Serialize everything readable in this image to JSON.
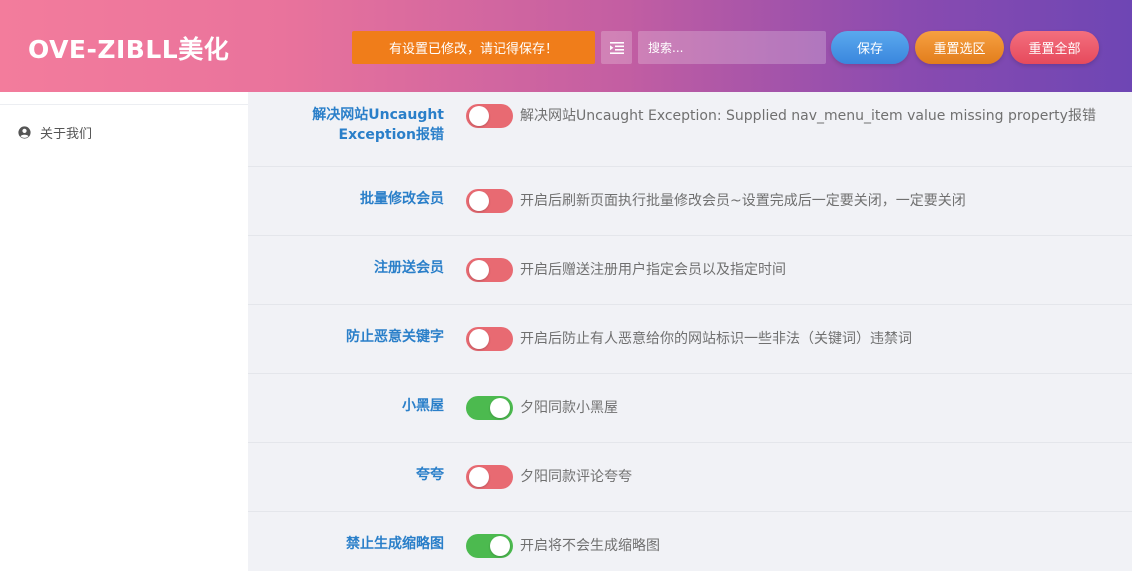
{
  "header": {
    "brand": "OVE-ZIBLL美化",
    "notice": "有设置已修改，请记得保存！",
    "search_placeholder": "搜索...",
    "save_label": "保存",
    "reset_section_label": "重置选区",
    "reset_all_label": "重置全部",
    "colors": {
      "notice": "#f07d1a",
      "save": "#3a86dd",
      "reset_section": "#e27d1c",
      "reset_all": "#e64a5c"
    }
  },
  "sidebar": {
    "items": [
      {
        "label": "关于我们",
        "icon": "user-circle-icon"
      }
    ]
  },
  "settings": [
    {
      "label": "解决网站Uncaught Exception报错",
      "label_lines": [
        "解决网站Uncaught",
        "Exception报错"
      ],
      "enabled": false,
      "desc": "解决网站Uncaught Exception: Supplied nav_menu_item value missing property报错"
    },
    {
      "label": "批量修改会员",
      "enabled": false,
      "desc": "开启后刷新页面执行批量修改会员~设置完成后一定要关闭，一定要关闭"
    },
    {
      "label": "注册送会员",
      "enabled": false,
      "desc": "开启后赠送注册用户指定会员以及指定时间"
    },
    {
      "label": "防止恶意关键字",
      "enabled": false,
      "desc": "开启后防止有人恶意给你的网站标识一些非法（关键词）违禁词"
    },
    {
      "label": "小黑屋",
      "enabled": true,
      "desc": "夕阳同款小黑屋"
    },
    {
      "label": "夸夸",
      "enabled": false,
      "desc": "夕阳同款评论夸夸"
    },
    {
      "label": "禁止生成缩略图",
      "enabled": true,
      "desc": "开启将不会生成缩略图"
    }
  ],
  "colors": {
    "toggle_off": "#e86a72",
    "toggle_on": "#4cba4f",
    "label": "#2a7fc9"
  }
}
